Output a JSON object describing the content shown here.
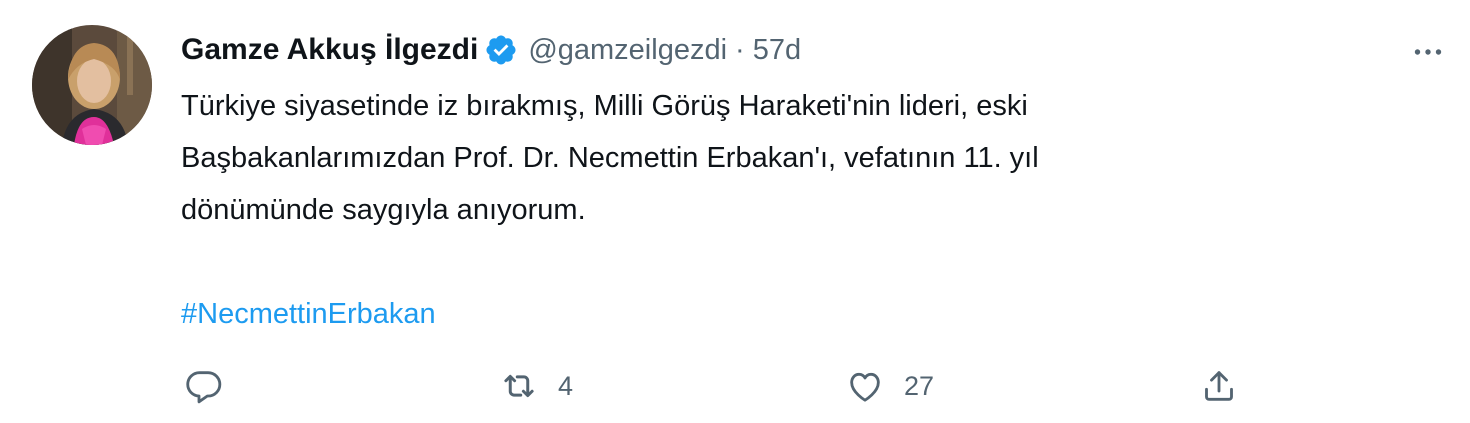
{
  "tweet": {
    "author": {
      "display_name": "Gamze Akkuş İlgezdi",
      "handle": "@gamzeilgezdi",
      "verified": true
    },
    "separator": "·",
    "time": "57d",
    "text": "Türkiye siyasetinde iz bırakmış, Milli Görüş Haraketi'nin lideri, eski\nBaşbakanlarımızdan Prof. Dr. Necmettin Erbakan'ı, vefatının 11. yıl\ndönümünde saygıyla anıyorum.",
    "hashtag": "#NecmettinErbakan",
    "actions": {
      "reply_icon": "reply-icon",
      "retweet_icon": "retweet-icon",
      "retweet_count": "4",
      "like_icon": "heart-icon",
      "like_count": "27",
      "share_icon": "share-icon"
    },
    "more_icon": "more-icon"
  },
  "colors": {
    "text_primary": "#0f1419",
    "text_secondary": "#536471",
    "accent": "#1d9bf0",
    "background": "#ffffff"
  }
}
